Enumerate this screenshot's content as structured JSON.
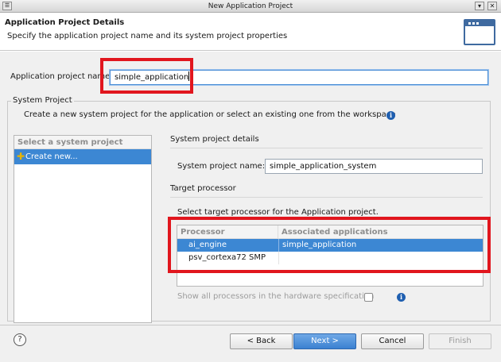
{
  "window": {
    "title": "New Application Project",
    "menu_glyph": "☰",
    "minimize_glyph": "▾",
    "close_glyph": "✕"
  },
  "header": {
    "title": "Application Project Details",
    "description": "Specify the application project name and its system project properties",
    "icon": "window-wizard-icon"
  },
  "project_name": {
    "label": "Application project name:",
    "value": "simple_application"
  },
  "system_project": {
    "group_title": "System Project",
    "instructions": "Create a new system project for the application or select an existing one from the workspace",
    "info_glyph": "i",
    "list": {
      "header": "Select a system project",
      "items": [
        {
          "label": "Create new...",
          "selected": true,
          "icon": "plus-icon",
          "glyph": "✚"
        }
      ]
    },
    "details": {
      "header": "System project details",
      "name_label": "System project name:",
      "name_value": "simple_application_system"
    }
  },
  "target_processor": {
    "header": "Target processor",
    "instructions": "Select target processor for the Application project.",
    "columns": [
      "Processor",
      "Associated applications"
    ],
    "rows": [
      {
        "processor": "ai_engine",
        "apps": "simple_application",
        "selected": true
      },
      {
        "processor": "psv_cortexa72 SMP",
        "apps": "",
        "selected": false
      }
    ],
    "show_all_label": "Show all processors in the hardware specification",
    "show_all_checked": false
  },
  "footer": {
    "help_glyph": "?",
    "back_label": "< Back",
    "next_label": "Next >",
    "cancel_label": "Cancel",
    "finish_label": "Finish"
  },
  "colors": {
    "accent": "#3c87d3",
    "highlight_red": "#e1161e",
    "info_blue": "#1f5fb0"
  }
}
